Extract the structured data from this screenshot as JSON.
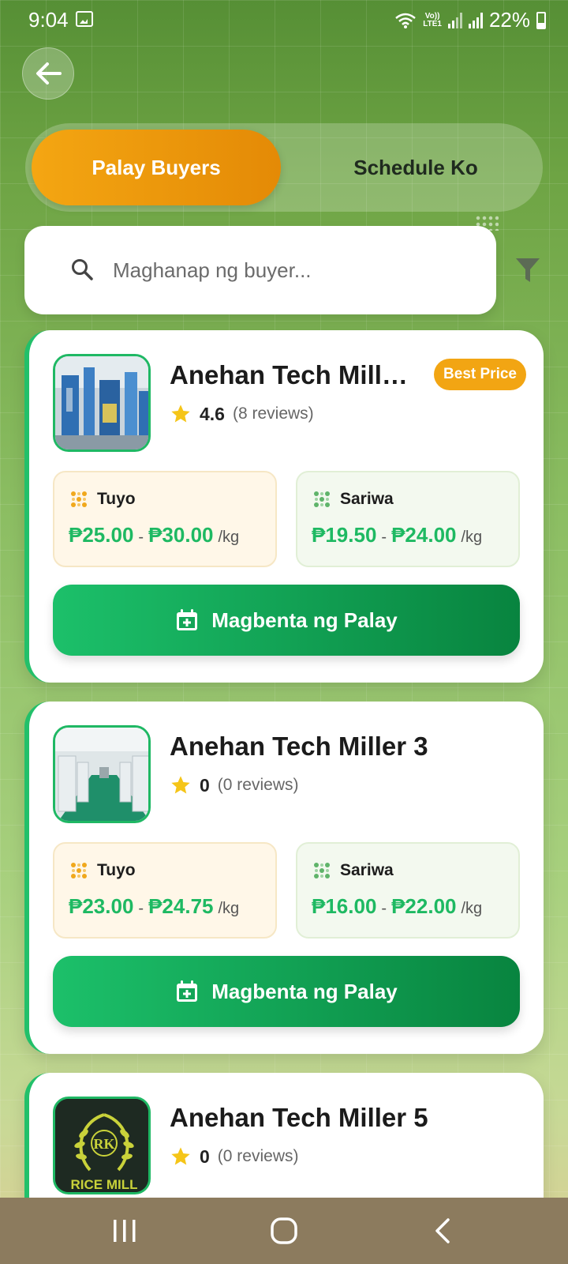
{
  "status_bar": {
    "time": "9:04",
    "network_label_top": "Vo))",
    "network_label_bottom": "LTE1",
    "battery": "22%"
  },
  "tabs": {
    "active_label": "Palay Buyers",
    "inactive_label": "Schedule Ko"
  },
  "search": {
    "placeholder": "Maghanap ng buyer..."
  },
  "buyers": [
    {
      "name": "Anehan Tech Miller...",
      "badge": "Best Price",
      "rating": "4.6",
      "reviews": "(8 reviews)",
      "dry_label": "Tuyo",
      "dry_min": "₱25.00",
      "dry_max": "₱30.00",
      "fresh_label": "Sariwa",
      "fresh_min": "₱19.50",
      "fresh_max": "₱24.00",
      "unit": "/kg",
      "separator": "-",
      "button": "Magbenta ng Palay"
    },
    {
      "name": "Anehan Tech Miller 3",
      "rating": "0",
      "reviews": "(0 reviews)",
      "dry_label": "Tuyo",
      "dry_min": "₱23.00",
      "dry_max": "₱24.75",
      "fresh_label": "Sariwa",
      "fresh_min": "₱16.00",
      "fresh_max": "₱22.00",
      "unit": "/kg",
      "separator": "-",
      "button": "Magbenta ng Palay"
    },
    {
      "name": "Anehan Tech Miller 5",
      "rating": "0",
      "reviews": "(0 reviews)",
      "logo_text": "RICE MILL",
      "logo_initials": "RK"
    }
  ],
  "colors": {
    "accent_orange": "#f2a513",
    "accent_green": "#1eb962",
    "button_green_dark": "#08843f"
  }
}
